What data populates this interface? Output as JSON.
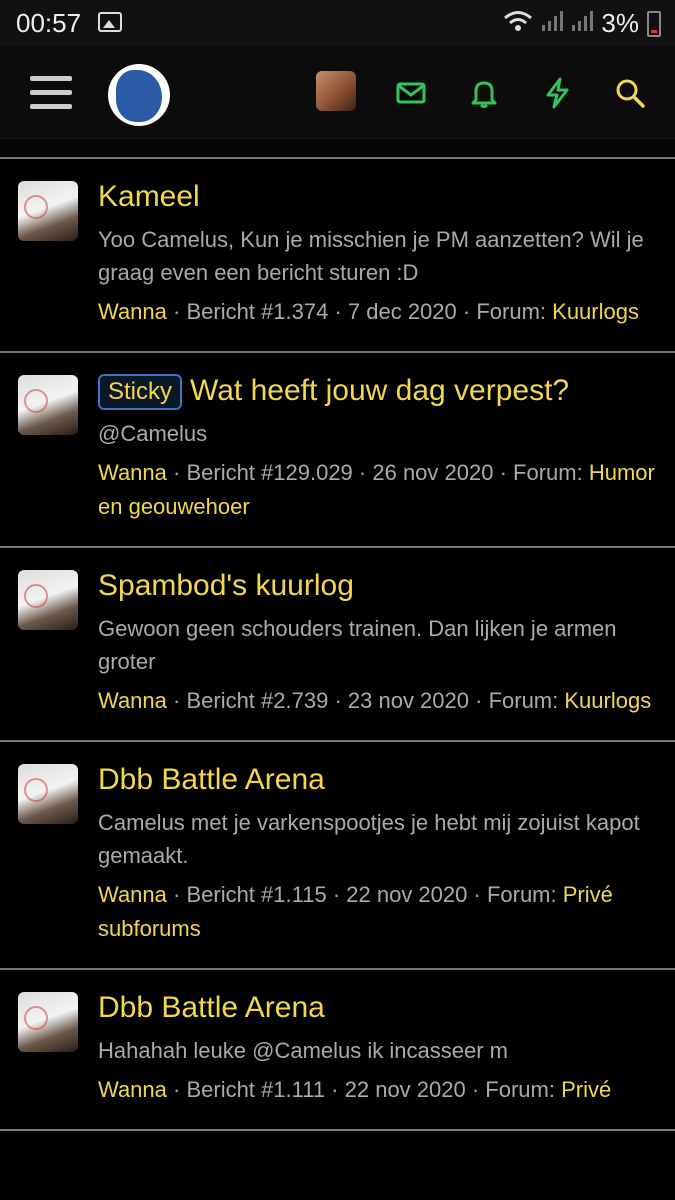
{
  "status_bar": {
    "time": "00:57",
    "battery": "3%"
  },
  "navbar": {
    "icons": [
      "menu-icon",
      "site-logo",
      "user-avatar",
      "mail-icon",
      "bell-icon",
      "lightning-icon",
      "search-icon"
    ],
    "colors": {
      "green": "#35c25b",
      "yellow": "#f2d74f"
    }
  },
  "items": [
    {
      "title": "Kameel",
      "sticky": false,
      "snippet": "Yoo Camelus, Kun je misschien je PM aanzetten? Wil je graag even een bericht sturen :D",
      "user": "Wanna",
      "post": "Bericht #1.374",
      "date": "7 dec 2020",
      "forum_label": "Forum:",
      "forum": "Kuurlogs"
    },
    {
      "title": "Wat heeft jouw dag verpest?",
      "sticky": true,
      "sticky_label": "Sticky",
      "snippet": "@Camelus",
      "user": "Wanna",
      "post": "Bericht #129.029",
      "date": "26 nov 2020",
      "forum_label": "Forum:",
      "forum": "Humor en geouwehoer"
    },
    {
      "title": "Spambod's kuurlog",
      "sticky": false,
      "snippet": "Gewoon geen schouders trainen. Dan lijken je armen groter",
      "user": "Wanna",
      "post": "Bericht #2.739",
      "date": "23 nov 2020",
      "forum_label": "Forum:",
      "forum": "Kuurlogs"
    },
    {
      "title": "Dbb Battle Arena",
      "sticky": false,
      "snippet": "Camelus met je varkenspootjes je hebt mij zojuist kapot gemaakt.",
      "user": "Wanna",
      "post": "Bericht #1.115",
      "date": "22 nov 2020",
      "forum_label": "Forum:",
      "forum": "Privé subforums"
    },
    {
      "title": "Dbb Battle Arena",
      "sticky": false,
      "snippet": "Hahahah leuke @Camelus ik incasseer m",
      "user": "Wanna",
      "post": "Bericht #1.111",
      "date": "22 nov 2020",
      "forum_label": "Forum:",
      "forum": "Privé"
    }
  ]
}
